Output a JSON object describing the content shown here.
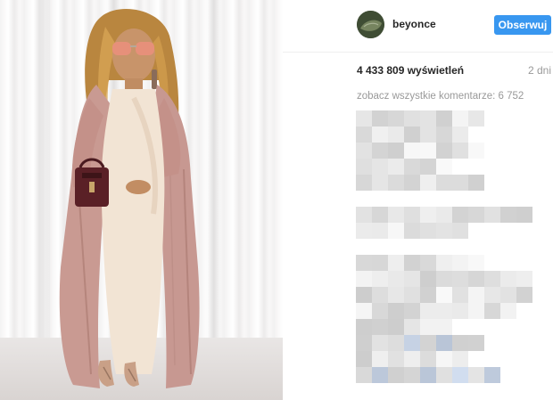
{
  "post": {
    "username": "beyonce",
    "follow_label": "Obserwuj",
    "views": "4 433 809 wyświetleń",
    "time": "2 dni",
    "view_all_comments": "zobacz wszystkie komentarze: 6 752"
  },
  "colors": {
    "follow_button": "#3897f0",
    "muted_text": "#999999",
    "primary_text": "#262626"
  },
  "icons": {
    "avatar": "profile-avatar"
  }
}
